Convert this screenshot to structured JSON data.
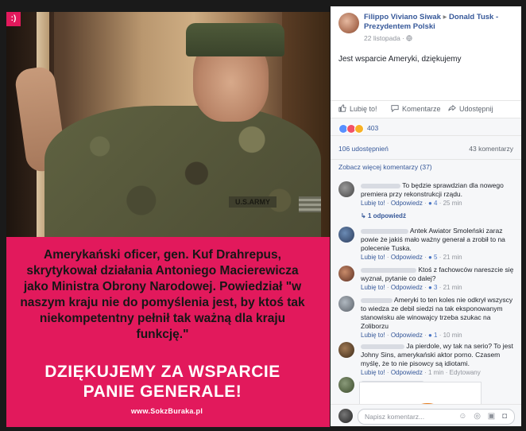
{
  "post": {
    "author": "Filippo Viviano Siwak",
    "arrow": "▸",
    "recipient": "Donald Tusk - Prezydentem Polski",
    "date": "22 listopada · ",
    "globe_icon": "globe-icon",
    "text": "Jest wsparcie Ameryki, dziękujemy"
  },
  "image": {
    "badge": ":)",
    "patch": "U.S.ARMY",
    "quote": "Amerykański oficer, gen. Kuf Drahrepus, skrytykował działania Antoniego Macierewicza jako Ministra Obrony Narodowej. Powiedział \"w naszym kraju nie do pomyślenia jest, by ktoś tak niekompetentny pełnił tak ważną dla kraju funkcję.\"",
    "thanks_line1": "DZIĘKUJEMY ZA WSPARCIE",
    "thanks_line2": "PANIE GENERALE!",
    "site": "www.SokzBuraka.pl"
  },
  "actions": {
    "like": "Lubię to!",
    "comment": "Komentarze",
    "share": "Udostępnij"
  },
  "reactions": {
    "count": "403",
    "colors": [
      "#5890ff",
      "#f25268",
      "#f7b125"
    ]
  },
  "stats": {
    "shares": "106 udostępnień",
    "comments": "43 komentarzy"
  },
  "more_comments": "Zobacz więcej komentarzy (37)",
  "comments": [
    {
      "text": "To będzie sprawdzian dla nowego premiera przy rekonstrukcji rządu.",
      "like": "Lubię to!",
      "reply": "Odpowiedz",
      "likes": "4",
      "time": "25 min",
      "replies": "1 odpowiedź"
    },
    {
      "text": "Antek Awiator Smoleński zaraz powie że jakiś mało ważny generał a zrobił to na polecenie Tuska.",
      "like": "Lubię to!",
      "reply": "Odpowiedz",
      "likes": "5",
      "time": "21 min"
    },
    {
      "text": "Ktoś z fachowców nareszcie się wyznał, pytanie co dalej?",
      "like": "Lubię to!",
      "reply": "Odpowiedz",
      "likes": "3",
      "time": "21 min"
    },
    {
      "text": "Ameryki to ten koles nie odkrył wszyscy to wiedza ze debil siedzi na tak eksponowanym stanowisku ale winowajcy trzeba szukac na Zoliborzu",
      "like": "Lubię to!",
      "reply": "Odpowiedz",
      "likes": "1",
      "time": "10 min"
    },
    {
      "text": "Ja pierdole, wy tak na serio? To jest Johny Sins, amerykański aktor porno. Czasem myślę, że to nie pisowcy są idiotami.",
      "like": "Lubię to!",
      "reply": "Odpowiedz",
      "time": "1 min",
      "edited": "Edytowany"
    }
  ],
  "write": {
    "placeholder": "Napisz komentarz...",
    "icons": "☺ ◎ ▣ ◘"
  }
}
